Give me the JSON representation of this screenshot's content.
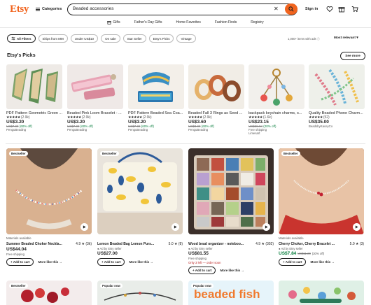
{
  "header": {
    "logo": "Etsy",
    "categories_label": "Categories",
    "search": {
      "value": "Beaded accessories",
      "clear_icon": "close-icon",
      "submit_icon": "search-icon"
    },
    "signin_label": "Sign in",
    "icons": [
      "heart-icon",
      "gift-icon",
      "cart-icon"
    ],
    "brand_color": "#F1641E"
  },
  "nav": [
    {
      "label": "Gifts",
      "icon": "gift-icon"
    },
    {
      "label": "Father's Day Gifts"
    },
    {
      "label": "Home Favorites"
    },
    {
      "label": "Fashion Finds"
    },
    {
      "label": "Registry"
    }
  ],
  "filters": {
    "chips": [
      "All Filters",
      "Ships from MM",
      "Under US$10",
      "On sale",
      "Star Seller",
      "Etsy's Picks",
      "Vintage"
    ],
    "results_text": "1,000+ items with ads",
    "sort_label": "Most relevant"
  },
  "picks": {
    "title": "Etsy's Picks",
    "see_more": "See more",
    "items": [
      {
        "title": "PDF Pattern Geometric Green ...",
        "stars": "★★★★★",
        "count": "(2.9k)",
        "price": "US$3.20",
        "was": "US$7.99",
        "off": "(60% off)",
        "shop": "PenguBeading"
      },
      {
        "title": "Beaded Pink Loom Bracelet - ...",
        "stars": "★★★★★",
        "count": "(2.9k)",
        "price": "US$3.20",
        "was": "US$7.99",
        "off": "(60% off)",
        "shop": "PenguBeading"
      },
      {
        "title": "PDF Pattern Beaded Sea Coa...",
        "stars": "★★★★★",
        "count": "(2.9k)",
        "price": "US$3.20",
        "was": "US$7.99",
        "off": "(60% off)",
        "shop": "PenguBeading"
      },
      {
        "title": "Beaded Fall 3 Rings as Seed ...",
        "stars": "★★★★★",
        "count": "(2.9k)",
        "price": "US$3.60",
        "was": "US$8.99",
        "off": "(60% off)",
        "shop": "PenguBeading"
      },
      {
        "title": "backpack keychain charms, s...",
        "stars": "★★★★★",
        "count": "(1.6k)",
        "price": "US$23.15",
        "was": "US$28.94",
        "off": "(20% off)",
        "shop": "Free shipping",
        "shop2": "Limesart"
      },
      {
        "title": "Quality Beaded Phone Charm...",
        "stars": "★★★★★",
        "count": "(52)",
        "price": "US$35.00",
        "was": "",
        "off": "",
        "shop": "BeadsbyKaceyCo"
      }
    ]
  },
  "listings": [
    {
      "badge": "Bestseller",
      "meta": "Materials available",
      "title": "Summer Beaded Choker Neckla...",
      "rating": "4.9 ★ (3k)",
      "ad": "",
      "price": "US$44.04",
      "was": "",
      "pct": "",
      "ship": "Free shipping",
      "ship_red": "",
      "add_label": "+ Add to cart",
      "more_label": "More like this →"
    },
    {
      "badge": "Bestseller",
      "meta": "",
      "title": "Lemon Beaded Bag Lemon Purs...",
      "rating": "5.0 ★ (8)",
      "ad": "Ad by Etsy seller",
      "price": "US$27.00",
      "was": "",
      "pct": "",
      "ship": "",
      "ship_red": "",
      "add_label": "+ Add to cart",
      "more_label": "More like this →"
    },
    {
      "badge": "",
      "meta": "",
      "title": "Wood bead organizer - noteboo...",
      "rating": "4.9 ★ (302)",
      "ad": "Ad by Etsy seller",
      "price": "US$81.55",
      "was": "",
      "pct": "",
      "ship": "Free shipping",
      "ship_red": "Only 3 left — order soon",
      "add_label": "+ Add to cart",
      "more_label": "More like this →"
    },
    {
      "badge": "Bestseller",
      "meta": "Materials available",
      "title": "Cherry Choker, Cherry Bracelet ...",
      "rating": "5.0 ★ (3)",
      "ad": "Ad by Etsy seller",
      "price": "US$7.84",
      "was": "US$11.20",
      "pct": "(30% off)",
      "ship": "",
      "ship_red": "",
      "add_label": "+ Add to cart",
      "more_label": "More like this →"
    }
  ],
  "bottom_row": [
    {
      "badge": "Bestseller"
    },
    {
      "badge": "Popular now"
    },
    {
      "badge": "Popular now",
      "overlay_text": "beaded fish"
    },
    {
      "badge": ""
    }
  ]
}
